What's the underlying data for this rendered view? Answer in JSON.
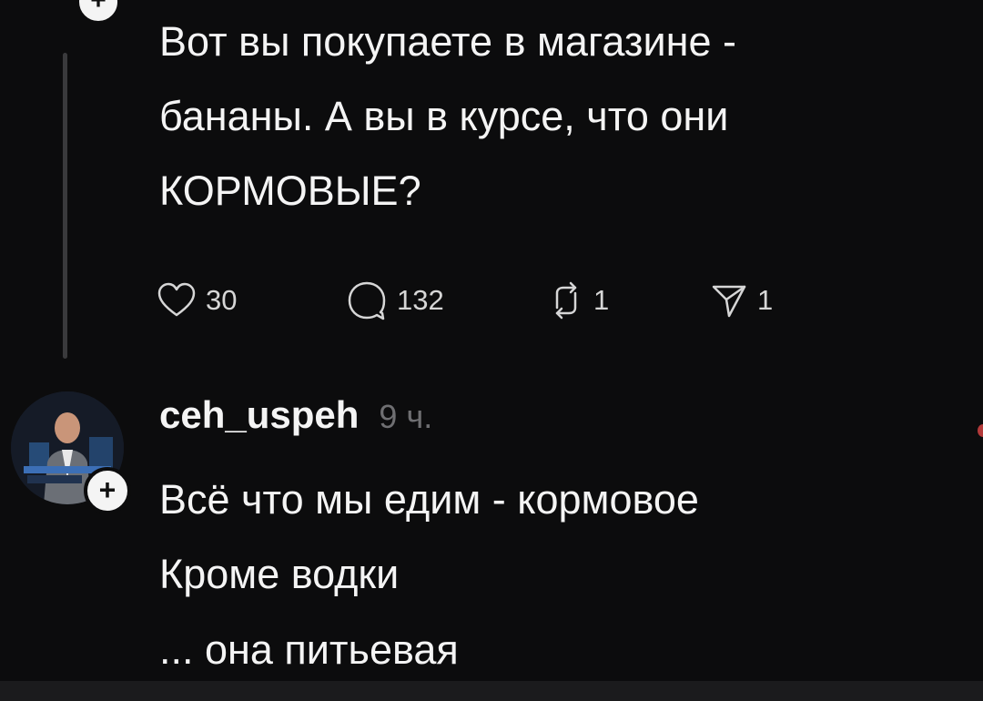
{
  "parent_post": {
    "lines": [
      "Вот вы покупаете в магазине -",
      "бананы. А вы в курсе, что они",
      "КОРМОВЫЕ?"
    ],
    "actions": {
      "likes": "30",
      "comments": "132",
      "reposts": "1",
      "shares": "1"
    }
  },
  "reply": {
    "username": "ceh_uspeh",
    "timestamp": "9 ч.",
    "lines": [
      "Всё что мы едим - кормовое",
      "Кроме водки",
      "... она питьевая"
    ]
  },
  "icons": {
    "like": "heart-icon",
    "comment": "speech-bubble-icon",
    "repost": "repost-arrows-icon",
    "share": "paper-plane-icon",
    "follow": "plus-icon"
  },
  "colors": {
    "background": "#0c0c0d",
    "text": "#f4f4f4",
    "muted": "#6f6f72"
  }
}
